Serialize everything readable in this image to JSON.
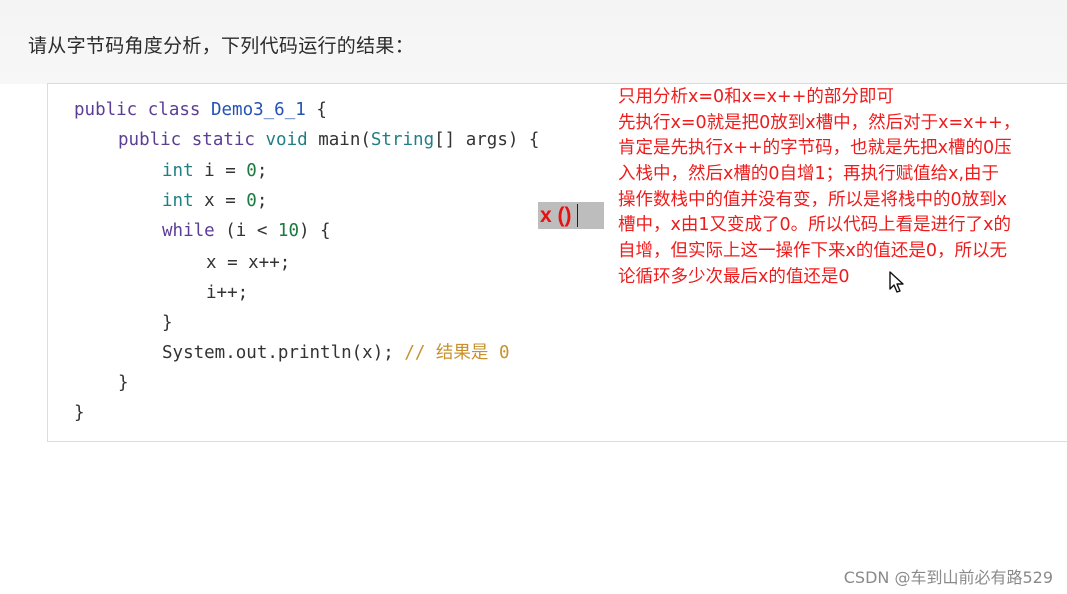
{
  "question": "请从字节码角度分析，下列代码运行的结果：",
  "code": {
    "line1": {
      "kw": "public class ",
      "cls": "Demo3_6_1",
      "rest": " {"
    },
    "line2": {
      "kw1": "public static ",
      "ty": "void",
      "pl": " main(",
      "cls": "String",
      "rest": "[] args) {"
    },
    "line3": {
      "ty": "int",
      "pl": " i = ",
      "num": "0",
      "rest": ";"
    },
    "line4": {
      "ty": "int",
      "pl": " x = ",
      "num": "0",
      "rest": ";"
    },
    "line5": {
      "kw": "while",
      "pl": " (i < ",
      "num": "10",
      "rest": ") {"
    },
    "line6": "x = x++;",
    "line7": "i++;",
    "line8": "}",
    "line9": {
      "pl": "System.out.println(x); ",
      "cm": "// 结果是 ",
      "num": "0"
    },
    "line10": "}",
    "line11": "}"
  },
  "overlay_text": "x ()",
  "annotation": [
    "只用分析x=0和x=x++的部分即可",
    "先执行x=0就是把0放到x槽中，然后对于x=x++，",
    "肯定是先执行x++的字节码，也就是先把x槽的0压",
    "入栈中，然后x槽的0自增1；再执行赋值给x,由于",
    "操作数栈中的值并没有变，所以是将栈中的0放到x",
    "槽中，x由1又变成了0。所以代码上看是进行了x的",
    "自增，但实际上这一操作下来x的值还是0，所以无",
    "论循环多少次最后x的值还是0"
  ],
  "watermark": "CSDN @车到山前必有路529",
  "colors": {
    "annotation": "#ee1c1c",
    "keyword": "#5b3d96",
    "type": "#1f7f84",
    "class": "#2553b5",
    "number": "#1a7a3f",
    "comment": "#c9912e"
  },
  "icons": {
    "cursor": "mouse-pointer-icon"
  }
}
